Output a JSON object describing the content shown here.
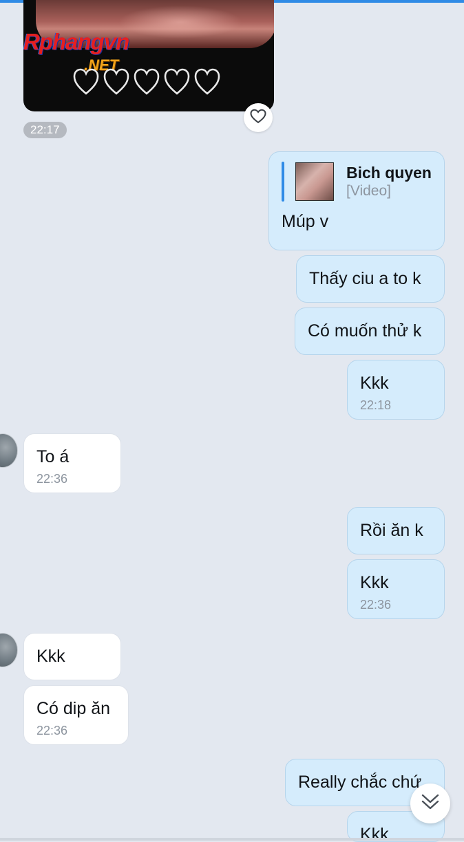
{
  "media": {
    "watermark_logo": "Rphangvn",
    "watermark_net": ".NET",
    "heart_count": 5,
    "time": "22:17"
  },
  "messages": {
    "reply": {
      "quote_name": "Bich quyen",
      "quote_type": "[Video]",
      "text": "Múp v"
    },
    "m2": {
      "text": "Thấy ciu a to k"
    },
    "m3": {
      "text": "Có muốn thử k"
    },
    "m4": {
      "text": "Kkk",
      "time": "22:18"
    },
    "m5": {
      "text": "To á",
      "time": "22:36"
    },
    "m6": {
      "text": "Rồi ăn k"
    },
    "m7": {
      "text": "Kkk",
      "time": "22:36"
    },
    "m8": {
      "text": "Kkk"
    },
    "m9": {
      "text": "Có dip ăn",
      "time": "22:36"
    },
    "m10": {
      "text": "Really chắc chứ"
    },
    "m11": {
      "text": "Kkk"
    }
  },
  "icons": {
    "like": "heart-outline-icon",
    "scroll": "double-chevron-down-icon"
  },
  "colors": {
    "background": "#e3e8f0",
    "outgoing_bubble": "#d5ecfc",
    "incoming_bubble": "#ffffff",
    "accent": "#2f8be6"
  }
}
